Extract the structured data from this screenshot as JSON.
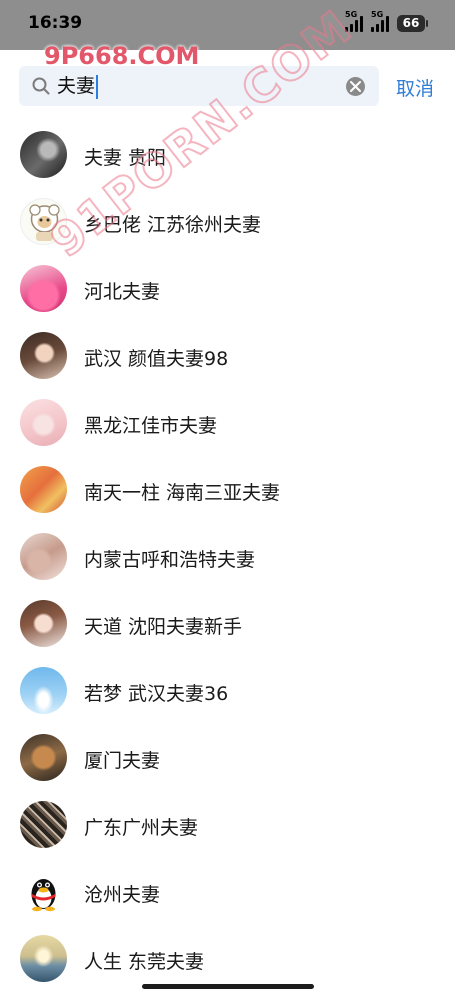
{
  "status_bar": {
    "time": "16:39",
    "signal_1_label": "5G",
    "signal_2_label": "5G",
    "battery": "66"
  },
  "search": {
    "query": "夫妻",
    "cancel_label": "取消"
  },
  "results": [
    {
      "label": "夫妻 贵阳",
      "avatar": "photo-hand-dark"
    },
    {
      "label": "乡巴佬 江苏徐州夫妻",
      "avatar": "cartoon-sheep"
    },
    {
      "label": "河北夫妻",
      "avatar": "photo-pink-shirt"
    },
    {
      "label": "武汉 颜值夫妻98",
      "avatar": "photo-woman"
    },
    {
      "label": "黑龙江佳市夫妻",
      "avatar": "illustration-boy"
    },
    {
      "label": "南天一柱 海南三亚夫妻",
      "avatar": "photo-warm-tones"
    },
    {
      "label": "内蒙古呼和浩特夫妻",
      "avatar": "photo-feet"
    },
    {
      "label": "天道 沈阳夫妻新手",
      "avatar": "photo-doll-face"
    },
    {
      "label": "若梦 武汉夫妻36",
      "avatar": "blue-sky"
    },
    {
      "label": "厦门夫妻",
      "avatar": "photo-dog"
    },
    {
      "label": "广东广州夫妻",
      "avatar": "photo-lace"
    },
    {
      "label": "沧州夫妻",
      "avatar": "qq-penguin"
    },
    {
      "label": "人生 东莞夫妻",
      "avatar": "sunset-water"
    }
  ],
  "watermarks": {
    "top": "9P668.COM",
    "diagonal": "91PORN.COM"
  },
  "colors": {
    "accent": "#2f7fd6",
    "status_bar_bg": "#8e8e8e",
    "search_bg": "#eef3f9"
  }
}
